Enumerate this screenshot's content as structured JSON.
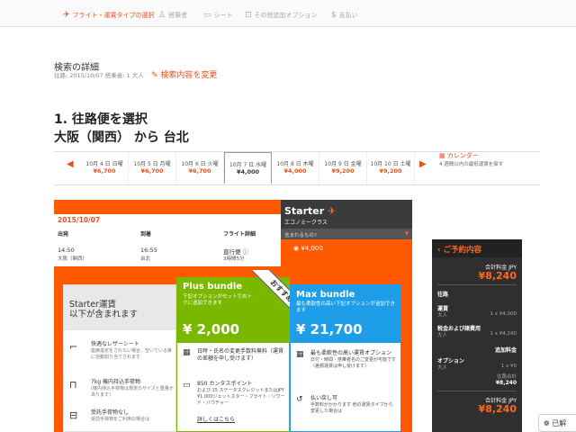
{
  "steps": [
    {
      "icon": "plane-icon",
      "label": "フライト・運賃タイプの選択",
      "active": true
    },
    {
      "icon": "person-icon",
      "label": "搭乗者",
      "active": false
    },
    {
      "icon": "seat-icon",
      "label": "シート",
      "active": false
    },
    {
      "icon": "bus-icon",
      "label": "その他追加オプション",
      "active": false
    },
    {
      "icon": "dollar-icon",
      "label": "支払い",
      "active": false
    }
  ],
  "search": {
    "title": "検索の詳細",
    "sub": "往路: 2015/10/07 搭乗者: 1 大人",
    "change_link": "検索内容を変更"
  },
  "route": {
    "line1": "1. 往路便を選択",
    "line2": "大阪（関西） から 台北"
  },
  "dates": [
    {
      "label": "10月 4 日 日曜",
      "price": "¥6,700"
    },
    {
      "label": "10月 5 日 月曜",
      "price": "¥6,700"
    },
    {
      "label": "10月 6 日 火曜",
      "price": "¥6,700"
    },
    {
      "label": "10月 7 日 水曜",
      "price": "¥4,000",
      "selected": true
    },
    {
      "label": "10月 8 日 木曜",
      "price": "¥4,000"
    },
    {
      "label": "10月 9 日 金曜",
      "price": "¥9,200"
    },
    {
      "label": "10月 10 日 土曜",
      "price": "¥9,200"
    }
  ],
  "calendar": {
    "label": "カレンダー",
    "sub": "4 週間以内の最低運賃を探す"
  },
  "flight": {
    "date": "2015/10/07",
    "col_depart": "出発",
    "col_arrive": "到着",
    "col_detail": "フライト詳細",
    "depart_time": "14:50",
    "depart_place": "大阪（関西）",
    "arrive_time": "16:55",
    "arrive_place": "台北",
    "direct": "直行便",
    "duration": "3時間5分"
  },
  "starter": {
    "title": "Starter",
    "subtitle": "エコノミークラス",
    "question": "含まれるもの?",
    "price": "¥4,000"
  },
  "starter_box": {
    "heading_1": "Starter運賃",
    "heading_2": "以下が含まれます",
    "features": [
      {
        "icon": "seat-icon",
        "title": "快適なレザーシート",
        "desc": "座席指定をされない場合、空いている席に自動割り当てされます"
      },
      {
        "icon": "luggage-icon",
        "title": "7kg 機内持込手荷物",
        "desc": "(機内持込手荷物は規定のサイズと重量があります)"
      },
      {
        "icon": "bag-icon",
        "title": "受託手荷物なし",
        "desc": "受託手荷物をご利用の場合は"
      }
    ]
  },
  "plus": {
    "name": "Plus bundle",
    "desc": "下記オプションがセットでおトクに追加できます",
    "price": "¥ 2,000",
    "ribbon": "おすすめ",
    "features": [
      {
        "icon": "calendar-icon",
        "title": "日時・氏名の変更手数料無料（運賃の差額を申し受けます）"
      },
      {
        "icon": "card-icon",
        "title": "850 カンタスポイント",
        "desc": "および 15 ステータスクレジットまたはJPY ¥1,000ジェットスター・フライト・リワード・バウチャー"
      },
      {
        "icon": "info-icon",
        "title": "詳しくはこちら"
      }
    ]
  },
  "max": {
    "name": "Max bundle",
    "desc": "最も柔軟性の高い下記オプションが追加できます",
    "price": "¥ 21,700",
    "features": [
      {
        "icon": "calendar-icon",
        "title": "最も柔軟性の高い運賃オプション",
        "desc": "日付・時間・搭乗者名のご変更が可能です（差額運賃は申し受けます）"
      },
      {
        "icon": "refund-icon",
        "title": "払い戻し可",
        "desc": "手数料がかかります 他の運賃タイプから変更した場合は"
      }
    ]
  },
  "summary": {
    "title": "ご予約内容",
    "total_label": "合計料金 JPY",
    "total": "¥8,240",
    "outbound": "往路",
    "fare_label": "運賃",
    "adult": "大人",
    "fare_line": "1 x ¥4,000",
    "tax_label": "税金および諸費用",
    "tax_line": "1 x ¥4,240",
    "extras_label": "追加料金",
    "option_label": "オプション",
    "option_line": "1 x ¥0",
    "subtotal_label": "往路合計",
    "subtotal": "¥8,240",
    "total_label2": "合計料金 JPY",
    "total2": "¥8,240"
  },
  "float_button": "已解"
}
